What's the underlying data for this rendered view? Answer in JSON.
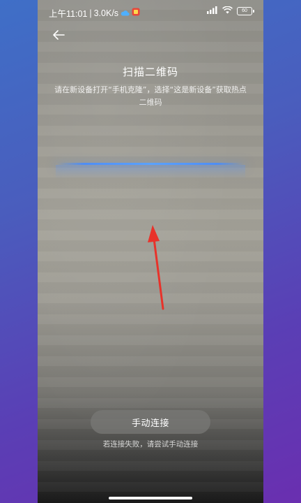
{
  "status_bar": {
    "time": "上午11:01",
    "separator": "|",
    "network_speed": "3.0K/s",
    "signal": "4G",
    "battery_level": "60"
  },
  "header": {
    "title": "扫描二维码",
    "subtitle": "请在新设备打开“手机克隆”，选择“这是新设备”获取热点二维码"
  },
  "actions": {
    "manual_connect_label": "手动连接",
    "hint": "若连接失败，请尝试手动连接"
  },
  "colors": {
    "scan_line": "#5aa2ff",
    "annotation_arrow": "#e8322a"
  }
}
